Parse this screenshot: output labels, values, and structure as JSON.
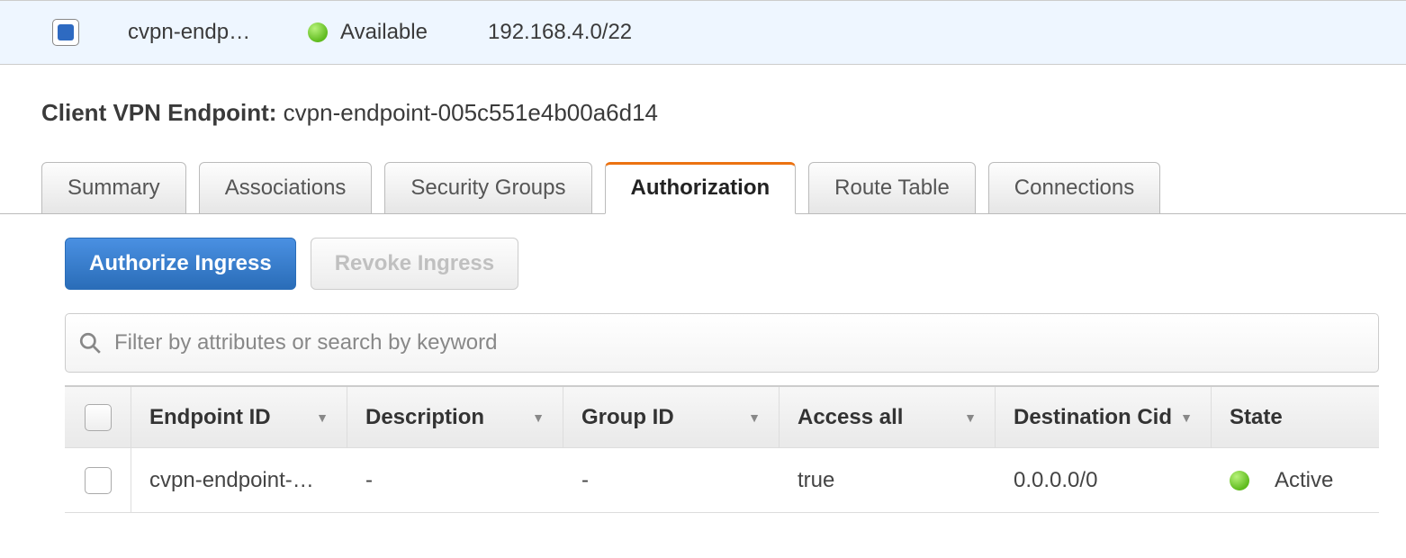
{
  "topRow": {
    "name": "cvpn-endp…",
    "statusText": "Available",
    "cidr": "192.168.4.0/22"
  },
  "title": {
    "label": "Client VPN Endpoint:",
    "value": "cvpn-endpoint-005c551e4b00a6d14"
  },
  "tabs": {
    "summary": "Summary",
    "associations": "Associations",
    "securityGroups": "Security Groups",
    "authorization": "Authorization",
    "routeTable": "Route Table",
    "connections": "Connections"
  },
  "actions": {
    "authorize": "Authorize Ingress",
    "revoke": "Revoke Ingress"
  },
  "filter": {
    "placeholder": "Filter by attributes or search by keyword"
  },
  "authTable": {
    "headers": {
      "endpoint": "Endpoint ID",
      "description": "Description",
      "group": "Group ID",
      "access": "Access all",
      "dest": "Destination Cid",
      "state": "State"
    },
    "rows": [
      {
        "endpoint": "cvpn-endpoint-…",
        "description": "-",
        "group": "-",
        "access": "true",
        "dest": "0.0.0.0/0",
        "state": "Active"
      }
    ]
  }
}
